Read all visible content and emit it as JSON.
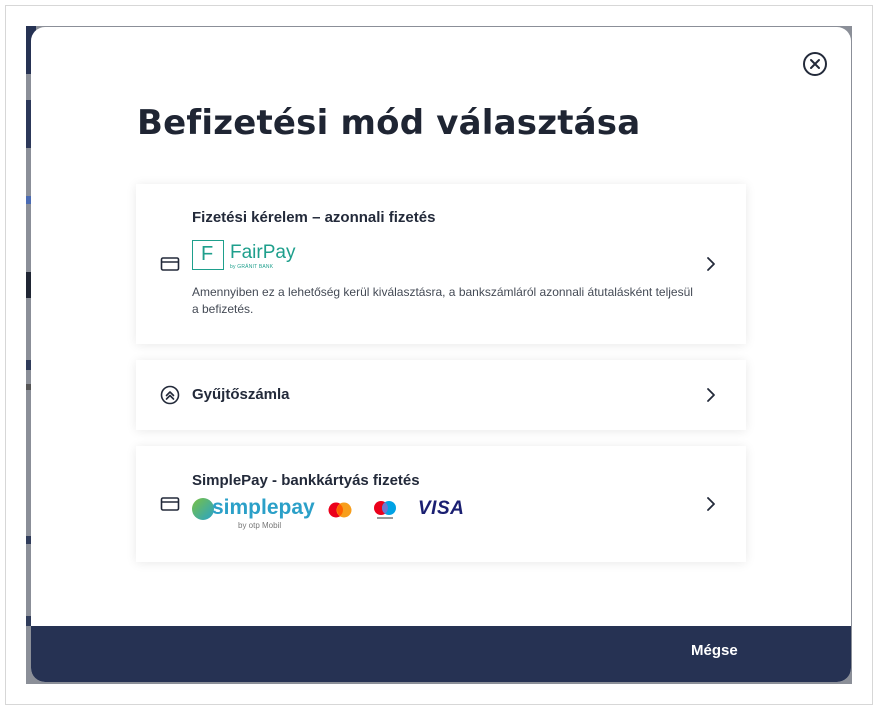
{
  "modal": {
    "title": "Befizetési mód választása",
    "close_icon": "close-circle-icon"
  },
  "options": [
    {
      "title": "Fizetési kérelem – azonnali fizetés",
      "icon": "credit-card-icon",
      "logo": {
        "letter": "F",
        "name": "FairPay",
        "sub": "by GRÁNIT BANK",
        "color": "#1e9f8c"
      },
      "description": "Amennyiben ez a lehetőség kerül kiválasztásra, a bankszámláról azonnali átutalásként teljesül a befizetés."
    },
    {
      "title": "Gyűjtőszámla",
      "icon": "double-chevron-up-circle-icon"
    },
    {
      "title": "SimplePay - bankkártyás fizetés",
      "icon": "credit-card-icon",
      "logos": {
        "simplepay": "simplepay",
        "simplepay_by": "by otp Mobil",
        "visa": "VISA"
      }
    }
  ],
  "footer": {
    "cancel_label": "Mégse",
    "bg_color": "#263253"
  }
}
